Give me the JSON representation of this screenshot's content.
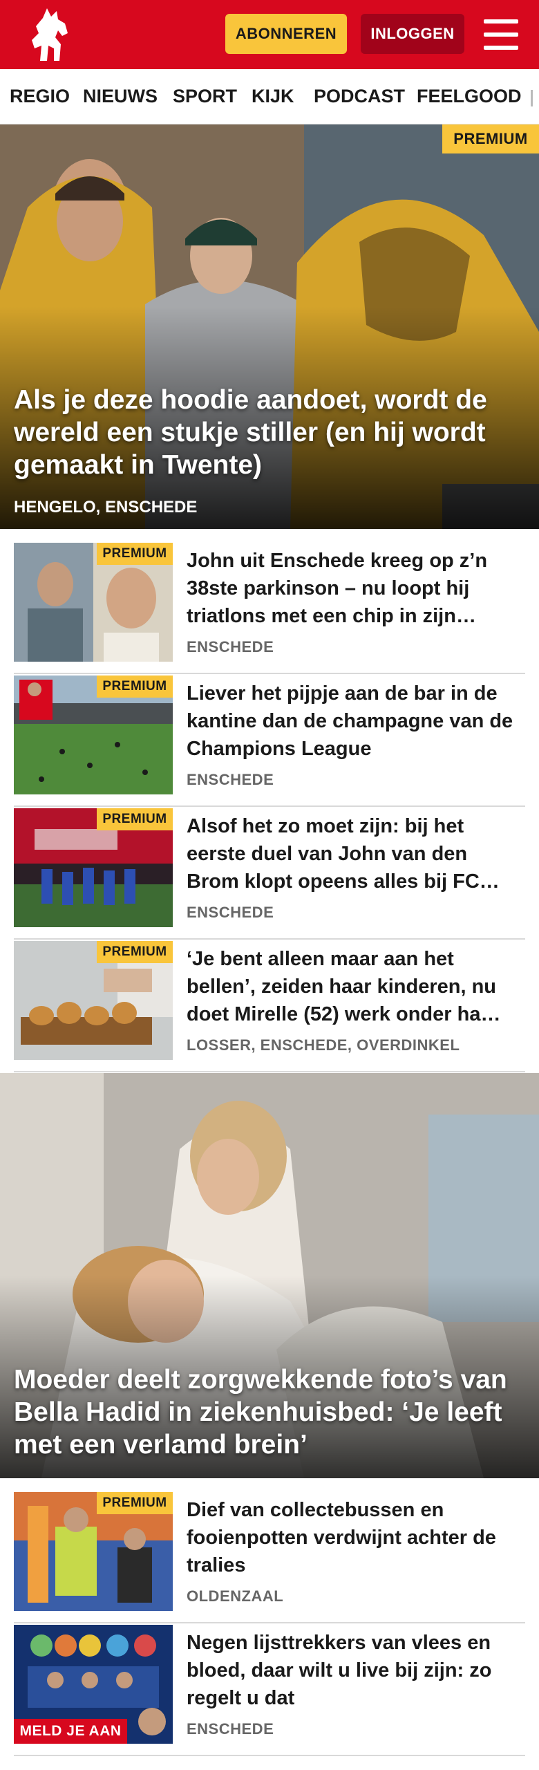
{
  "header": {
    "subscribe_label": "ABONNEREN",
    "login_label": "INLOGGEN",
    "logo_icon": "tubantia-horse-logo-icon",
    "menu_icon": "hamburger-menu-icon",
    "brand_color": "#d7081e",
    "accent_color": "#f9c53b"
  },
  "nav": {
    "items": [
      "REGIO",
      "NIEUWS",
      "SPORT",
      "KIJK",
      "PODCAST",
      "FEELGOOD"
    ]
  },
  "hero1": {
    "badge": "PREMIUM",
    "title": "Als je deze hoodie aandoet, wordt de wereld een stukje stiller (en hij wordt gemaakt in Twente)",
    "location": "HENGELO, ENSCHEDE"
  },
  "articles": [
    {
      "badge": "PREMIUM",
      "title": "John uit Enschede kreeg op z’n 38ste parkinson – nu loopt hij triatlons met een chip in zijn…",
      "location": "ENSCHEDE"
    },
    {
      "badge": "PREMIUM",
      "title": "Liever het pijpje aan de bar in de kantine dan de champagne van de Champions League",
      "location": "ENSCHEDE"
    },
    {
      "badge": "PREMIUM",
      "title": "Alsof het zo moet zijn: bij het eerste duel van John van den Brom klopt opeens alles bij FC…",
      "location": "ENSCHEDE"
    },
    {
      "badge": "PREMIUM",
      "title": "‘Je bent alleen maar aan het bellen’, zeiden haar kinderen, nu doet Mirelle (52) werk onder ha…",
      "location": "LOSSER, ENSCHEDE, OVERDINKEL"
    }
  ],
  "hero2": {
    "title": "Moeder deelt zorgwekkende foto’s van Bella Hadid in ziekenhuisbed: ‘Je leeft met een verlamd brein’"
  },
  "articles2": [
    {
      "badge": "PREMIUM",
      "title": "Dief van collectebussen en fooienpotten verdwijnt achter de tralies",
      "location": "OLDENZAAL"
    },
    {
      "badge": "MELD JE AAN",
      "title": "Negen lijsttrekkers van vlees en bloed, daar wilt u live bij zijn: zo regelt u dat",
      "location": "ENSCHEDE"
    }
  ]
}
